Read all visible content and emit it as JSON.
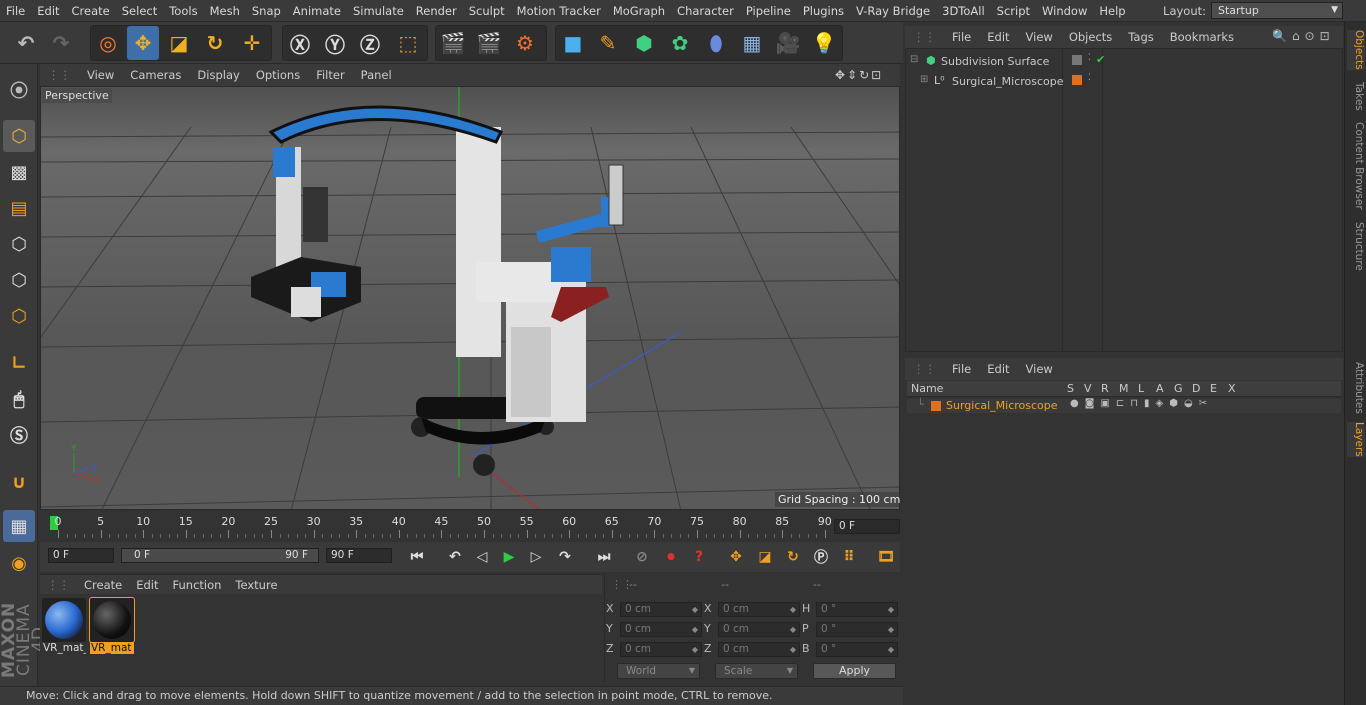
{
  "menubar": {
    "items": [
      "File",
      "Edit",
      "Create",
      "Select",
      "Tools",
      "Mesh",
      "Snap",
      "Animate",
      "Simulate",
      "Render",
      "Sculpt",
      "Motion Tracker",
      "MoGraph",
      "Character",
      "Pipeline",
      "Plugins",
      "V-Ray Bridge",
      "3DToAll",
      "Script",
      "Window",
      "Help"
    ],
    "layout_label": "Layout:",
    "layout_value": "Startup"
  },
  "viewport": {
    "menu": [
      "View",
      "Cameras",
      "Display",
      "Options",
      "Filter",
      "Panel"
    ],
    "label": "Perspective",
    "grid_spacing": "Grid Spacing : 100 cm",
    "axis_labels": {
      "y": "Y",
      "z": "Z",
      "x": "X"
    }
  },
  "timeline": {
    "ticks": [
      "0",
      "5",
      "10",
      "15",
      "20",
      "25",
      "30",
      "35",
      "40",
      "45",
      "50",
      "55",
      "60",
      "65",
      "70",
      "75",
      "80",
      "85",
      "90"
    ],
    "current_frame": "0 F"
  },
  "transport": {
    "start": "0 F",
    "range_start": "0 F",
    "range_end": "90 F",
    "end": "90 F"
  },
  "material_manager": {
    "menu": [
      "Create",
      "Edit",
      "Function",
      "Texture"
    ],
    "materials": [
      {
        "name": "VR_mat_",
        "selected": false
      },
      {
        "name": "VR_mat",
        "selected": true
      }
    ]
  },
  "coordinates": {
    "headers": [
      "--",
      "--",
      "--"
    ],
    "rows": [
      {
        "p_label": "X",
        "p_val": "0 cm",
        "s_label": "X",
        "s_val": "0 cm",
        "r_label": "H",
        "r_val": "0 °"
      },
      {
        "p_label": "Y",
        "p_val": "0 cm",
        "s_label": "Y",
        "s_val": "0 cm",
        "r_label": "P",
        "r_val": "0 °"
      },
      {
        "p_label": "Z",
        "p_val": "0 cm",
        "s_label": "Z",
        "s_val": "0 cm",
        "r_label": "B",
        "r_val": "0 °"
      }
    ],
    "mode": "World",
    "type": "Scale",
    "apply": "Apply"
  },
  "status": "Move: Click and drag to move elements. Hold down SHIFT to quantize movement / add to the selection in point mode, CTRL to remove.",
  "object_manager": {
    "menu": [
      "File",
      "Edit",
      "View",
      "Objects",
      "Tags",
      "Bookmarks"
    ],
    "objects": [
      {
        "name": "Subdivision Surface"
      },
      {
        "name": "Surgical_Microscope"
      }
    ]
  },
  "layer_manager": {
    "menu": [
      "File",
      "Edit",
      "View"
    ],
    "columns": [
      "Name",
      "S",
      "V",
      "R",
      "M",
      "L",
      "A",
      "G",
      "D",
      "E",
      "X"
    ],
    "layers": [
      {
        "name": "Surgical_Microscope",
        "color": "#e07020"
      }
    ]
  },
  "side_tabs": [
    "Objects",
    "Takes",
    "Content Browser",
    "Structure",
    "Attributes",
    "Layers"
  ],
  "brand": {
    "maxon": "MAXON",
    "product": "CINEMA 4D"
  },
  "colors": {
    "accent": "#4a90d9",
    "selected_text": "#f0a020",
    "layer_orange": "#e07020",
    "timeline_green": "#2ecc40"
  }
}
